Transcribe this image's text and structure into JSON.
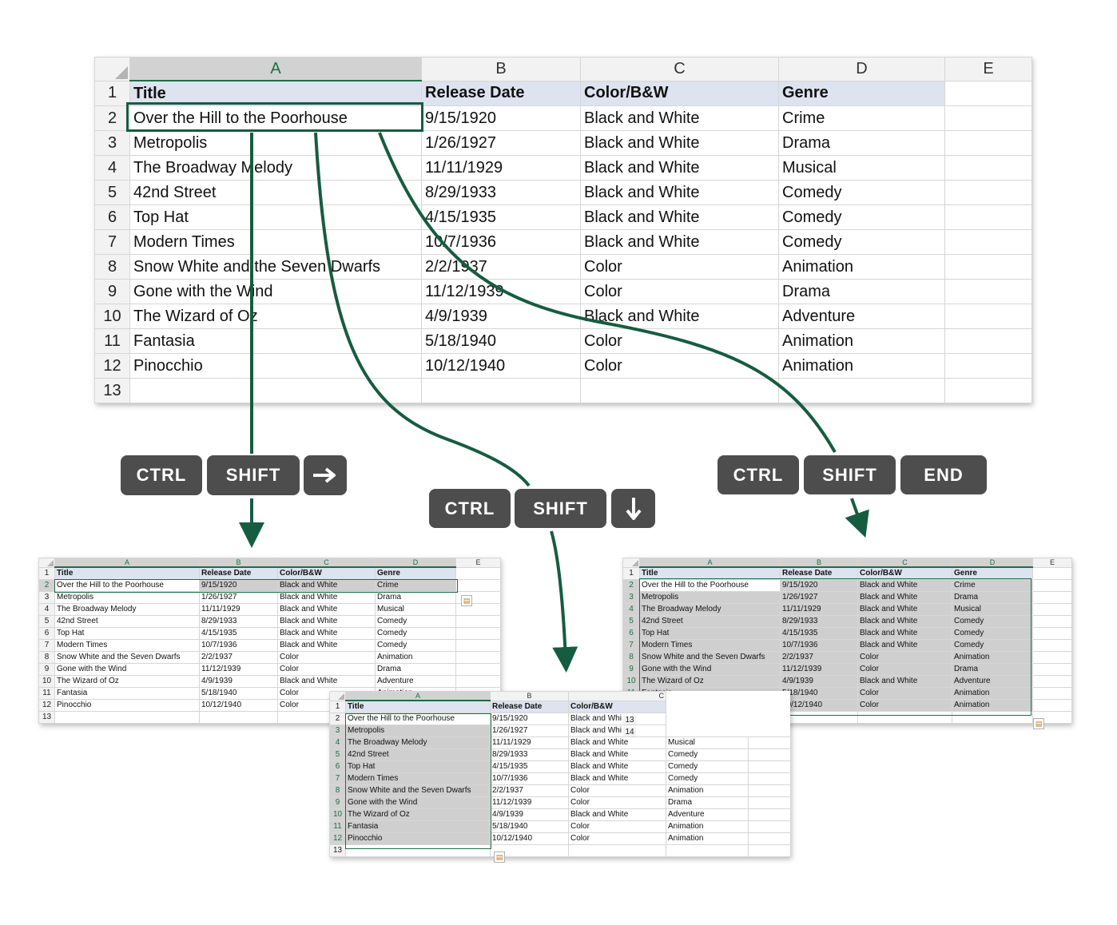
{
  "columns": [
    "A",
    "B",
    "C",
    "D",
    "E"
  ],
  "small_columns": {
    "left": [
      "A",
      "B",
      "C",
      "D",
      "E"
    ],
    "center": [
      "A",
      "B",
      "C"
    ],
    "right": [
      "A",
      "B",
      "C",
      "D",
      "E"
    ]
  },
  "header_row": {
    "num": "1",
    "cells": [
      "Title",
      "Release Date",
      "Color/B&W",
      "Genre",
      ""
    ]
  },
  "rows": [
    {
      "num": "2",
      "cells": [
        "Over the Hill to the Poorhouse",
        "9/15/1920",
        "Black and White",
        "Crime",
        ""
      ]
    },
    {
      "num": "3",
      "cells": [
        "Metropolis",
        "1/26/1927",
        "Black and White",
        "Drama",
        ""
      ]
    },
    {
      "num": "4",
      "cells": [
        "The Broadway Melody",
        "11/11/1929",
        "Black and White",
        "Musical",
        ""
      ]
    },
    {
      "num": "5",
      "cells": [
        "42nd Street",
        "8/29/1933",
        "Black and White",
        "Comedy",
        ""
      ]
    },
    {
      "num": "6",
      "cells": [
        "Top Hat",
        "4/15/1935",
        "Black and White",
        "Comedy",
        ""
      ]
    },
    {
      "num": "7",
      "cells": [
        "Modern Times",
        "10/7/1936",
        "Black and White",
        "Comedy",
        ""
      ]
    },
    {
      "num": "8",
      "cells": [
        "Snow White and the Seven Dwarfs",
        "2/2/1937",
        "Color",
        "Animation",
        ""
      ]
    },
    {
      "num": "9",
      "cells": [
        "Gone with the Wind",
        "11/12/1939",
        "Color",
        "Drama",
        ""
      ]
    },
    {
      "num": "10",
      "cells": [
        "The Wizard of Oz",
        "4/9/1939",
        "Black and White",
        "Adventure",
        ""
      ]
    },
    {
      "num": "11",
      "cells": [
        "Fantasia",
        "5/18/1940",
        "Color",
        "Animation",
        ""
      ]
    },
    {
      "num": "12",
      "cells": [
        "Pinocchio",
        "10/12/1940",
        "Color",
        "Animation",
        ""
      ]
    },
    {
      "num": "13",
      "cells": [
        "",
        "",
        "",
        "",
        ""
      ]
    }
  ],
  "center_truncated_c": [
    "Black and Whi",
    "Black and Whi"
  ],
  "center_overlap_row_nums": [
    "13",
    "14"
  ],
  "shortcuts": {
    "right_arrow": {
      "keys": [
        "CTRL",
        "SHIFT"
      ],
      "arrow": "right-arrow-icon"
    },
    "down_arrow": {
      "keys": [
        "CTRL",
        "SHIFT"
      ],
      "arrow": "down-arrow-icon"
    },
    "end": {
      "keys": [
        "CTRL",
        "SHIFT",
        "END"
      ]
    }
  },
  "colors": {
    "accent_green": "#165c40",
    "key_bg": "#4d4d4d",
    "header_fill": "#dde3ef",
    "selection_fill": "#cfcfcf"
  }
}
